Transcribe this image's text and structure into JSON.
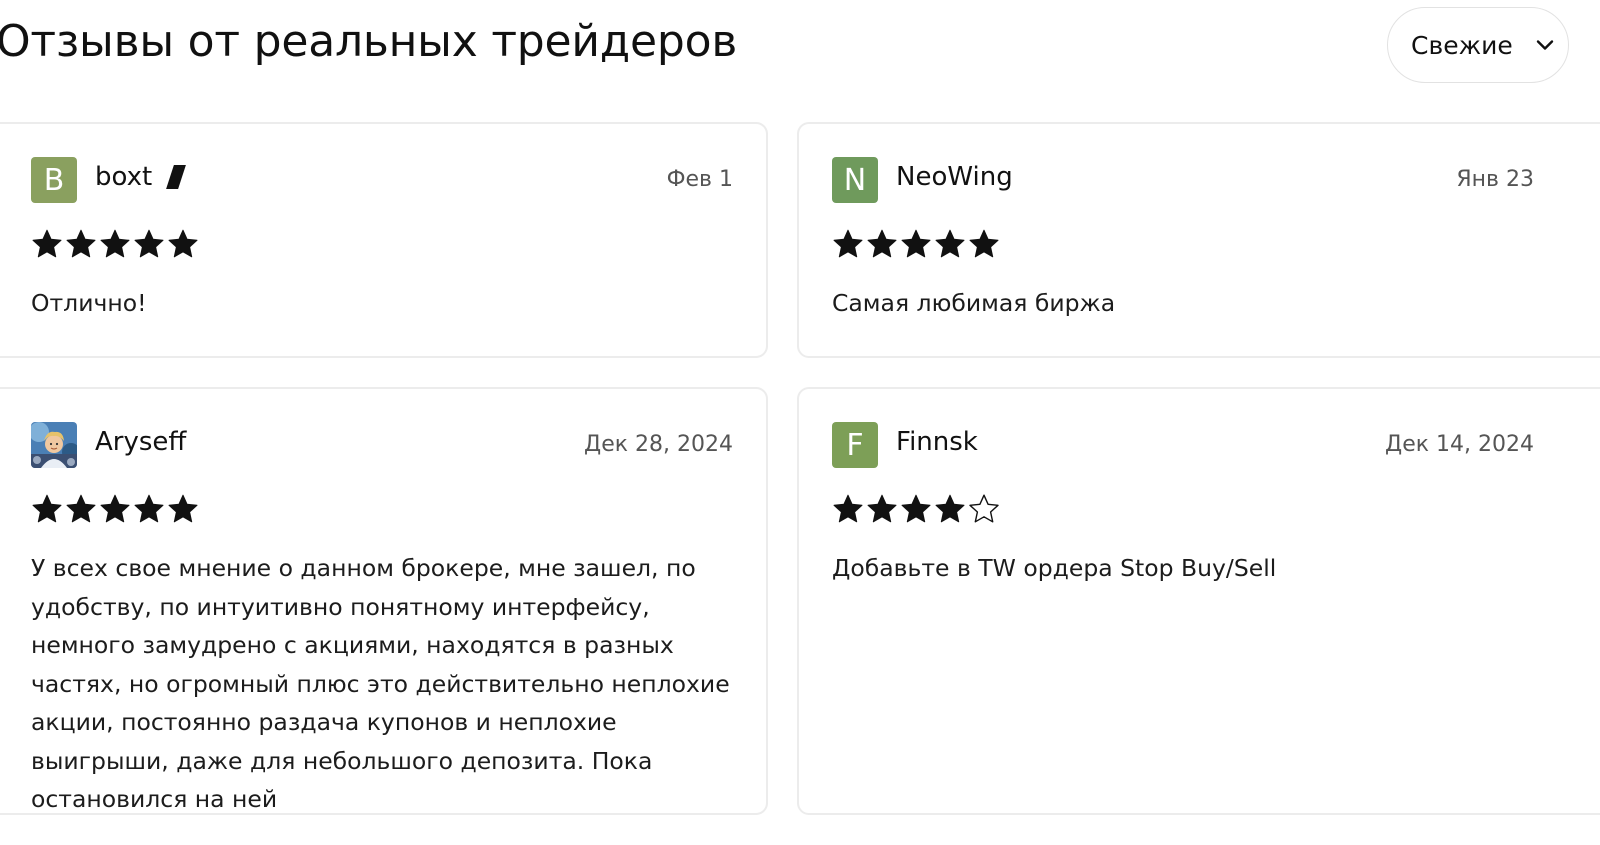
{
  "page_title": "Отзывы от реальных трейдеров",
  "sort": {
    "selected": "Свежие"
  },
  "reviews": [
    {
      "author": "boxt",
      "avatar_letter": "B",
      "avatar_color": "#8aa05f",
      "has_badge": true,
      "date": "Фев 1",
      "rating": 5,
      "text": "Отлично!"
    },
    {
      "author": "NeoWing",
      "avatar_letter": "N",
      "avatar_color": "#6f9a5c",
      "date": "Янв 23",
      "rating": 5,
      "text": "Самая любимая биржа"
    },
    {
      "author": "Aryseff",
      "avatar_icon": "photo-avatar-icon",
      "date": "Дек 28, 2024",
      "rating": 5,
      "text": "У всех свое мнение о данном брокере, мне зашел, по удобству, по интуитивно понятному интерфейсу, немного замудрено с акциями, находятся в разных частях, но огромный плюс это действительно неплохие акции, постоянно раздача купонов и неплохие выигрыши, даже для небольшого депозита. Пока остановился на ней"
    },
    {
      "author": "Finnsk",
      "avatar_letter": "F",
      "avatar_color": "#7d9f57",
      "date": "Дек 14, 2024",
      "rating": 4,
      "text": "Добавьте в TW ордера Stop Buy/Sell"
    }
  ],
  "colors": {
    "star_filled": "#111111",
    "card_border": "#ececec"
  }
}
